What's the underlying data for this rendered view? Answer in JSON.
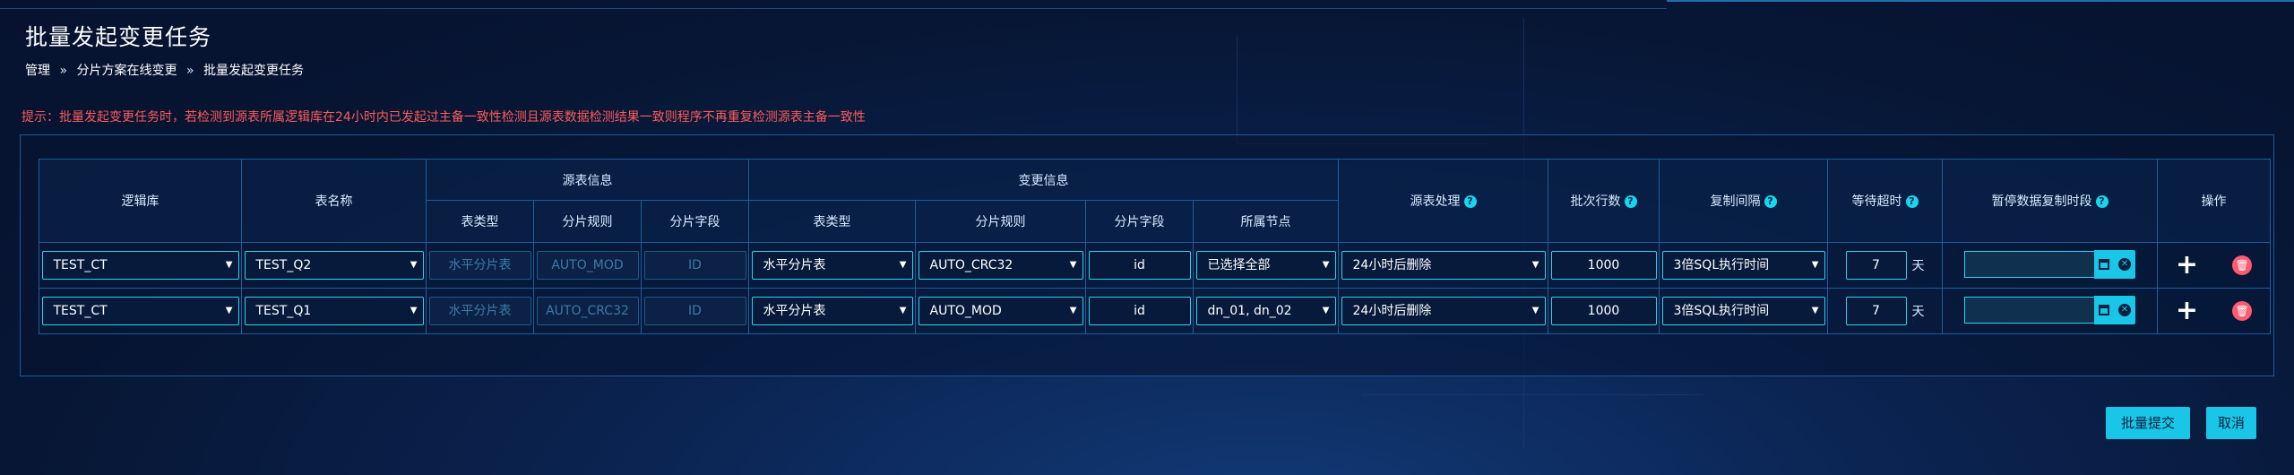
{
  "page": {
    "title": "批量发起变更任务",
    "breadcrumb": [
      "管理",
      "分片方案在线变更",
      "批量发起变更任务"
    ],
    "breadcrumb_sep": "»",
    "notice": "提示：批量发起变更任务时，若检测到源表所属逻辑库在24小时内已发起过主备一致性检测且源表数据检测结果一致则程序不再重复检测源表主备一致性"
  },
  "table": {
    "headers": {
      "logic_db": "逻辑库",
      "table_name": "表名称",
      "source_info": "源表信息",
      "change_info": "变更信息",
      "source_handling": "源表处理",
      "batch_rows": "批次行数",
      "replication_interval": "复制间隔",
      "wait_timeout": "等待超时",
      "pause_window": "暂停数据复制时段",
      "operations": "操作",
      "table_type": "表类型",
      "shard_rule": "分片规则",
      "shard_field": "分片字段",
      "node": "所属节点"
    },
    "help_icon": "?",
    "rows": [
      {
        "logic_db": "TEST_CT",
        "table_name": "TEST_Q2",
        "src_table_type": "水平分片表",
        "src_shard_rule": "AUTO_MOD",
        "src_shard_field": "ID",
        "chg_table_type": "水平分片表",
        "chg_shard_rule": "AUTO_CRC32",
        "chg_shard_field": "id",
        "chg_node": "已选择全部",
        "source_handling": "24小时后删除",
        "batch_rows": "1000",
        "replication_interval": "3倍SQL执行时间",
        "wait_timeout": "7",
        "wait_unit": "天",
        "pause_window": ""
      },
      {
        "logic_db": "TEST_CT",
        "table_name": "TEST_Q1",
        "src_table_type": "水平分片表",
        "src_shard_rule": "AUTO_CRC32",
        "src_shard_field": "ID",
        "chg_table_type": "水平分片表",
        "chg_shard_rule": "AUTO_MOD",
        "chg_shard_field": "id",
        "chg_node": "dn_01, dn_02",
        "source_handling": "24小时后删除",
        "batch_rows": "1000",
        "replication_interval": "3倍SQL执行时间",
        "wait_timeout": "7",
        "wait_unit": "天",
        "pause_window": ""
      }
    ]
  },
  "icons": {
    "dropdown": "caret-down-icon",
    "calendar": "calendar-icon",
    "clear": "clear-circle-icon",
    "add": "plus-icon",
    "delete": "trash-icon"
  },
  "actions": {
    "submit": "批量提交",
    "cancel": "取消"
  },
  "colors": {
    "accent": "#19c6e8",
    "notice": "#ff5a5a",
    "delete": "#ff5a70",
    "background": "#071634"
  }
}
